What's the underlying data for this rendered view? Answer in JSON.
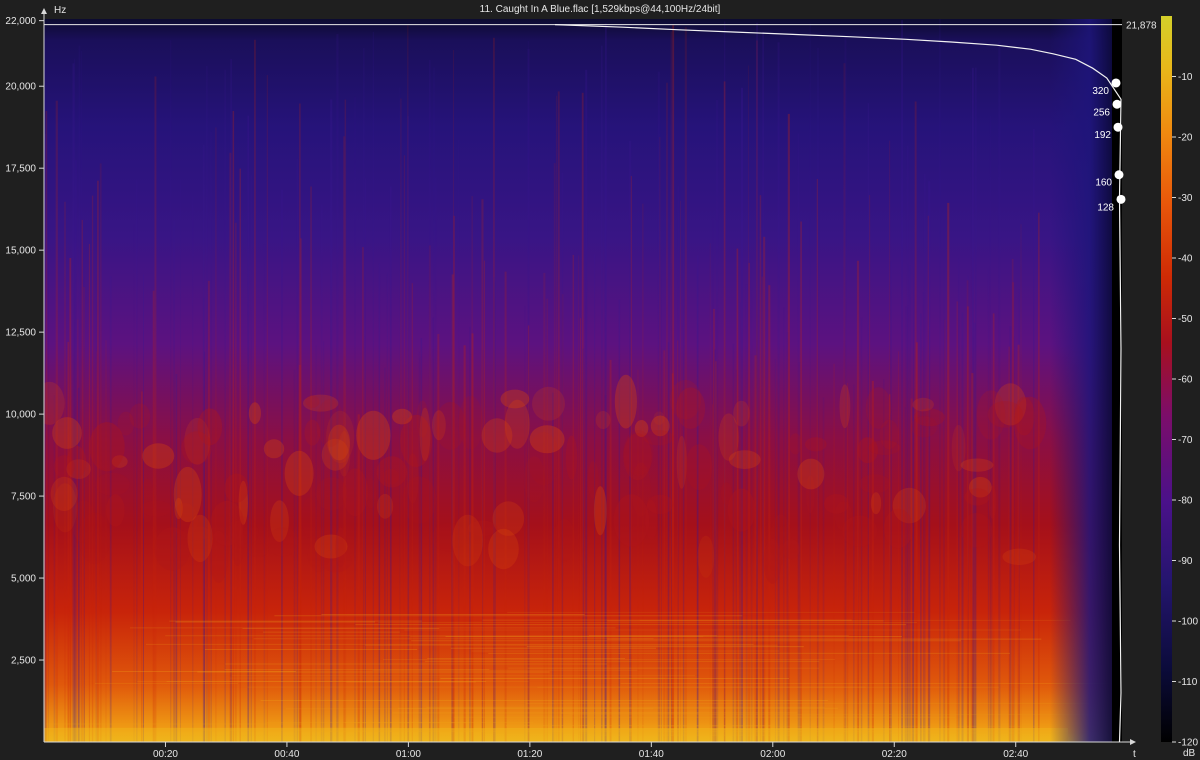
{
  "chart_data": {
    "type": "heatmap",
    "title": "11. Caught In A Blue.flac [1,529kbps@44,100Hz/24bit]",
    "ylabel": "Hz",
    "xlabel": "t",
    "colorbar_label": "dB",
    "y_ticks": [
      {
        "value": 22000,
        "label": "22,000"
      },
      {
        "value": 20000,
        "label": "20,000"
      },
      {
        "value": 17500,
        "label": "17,500"
      },
      {
        "value": 15000,
        "label": "15,000"
      },
      {
        "value": 12500,
        "label": "12,500"
      },
      {
        "value": 10000,
        "label": "10,000"
      },
      {
        "value": 7500,
        "label": "7,500"
      },
      {
        "value": 5000,
        "label": "5,000"
      },
      {
        "value": 2500,
        "label": "2,500"
      }
    ],
    "ylim": [
      0,
      22050
    ],
    "x_ticks": [
      {
        "value": 20,
        "label": "00:20"
      },
      {
        "value": 40,
        "label": "00:40"
      },
      {
        "value": 60,
        "label": "01:00"
      },
      {
        "value": 80,
        "label": "01:20"
      },
      {
        "value": 100,
        "label": "01:40"
      },
      {
        "value": 120,
        "label": "02:00"
      },
      {
        "value": 140,
        "label": "02:20"
      },
      {
        "value": 160,
        "label": "02:40"
      }
    ],
    "xlim": [
      0,
      177.5
    ],
    "colorbar_ticks": [
      {
        "value": -10,
        "label": "-10"
      },
      {
        "value": -20,
        "label": "-20"
      },
      {
        "value": -30,
        "label": "-30"
      },
      {
        "value": -40,
        "label": "-40"
      },
      {
        "value": -50,
        "label": "-50"
      },
      {
        "value": -60,
        "label": "-60"
      },
      {
        "value": -70,
        "label": "-70"
      },
      {
        "value": -80,
        "label": "-80"
      },
      {
        "value": -90,
        "label": "-90"
      },
      {
        "value": -100,
        "label": "-100"
      },
      {
        "value": -110,
        "label": "-110"
      },
      {
        "value": -120,
        "label": "-120"
      }
    ],
    "colorbar_range": [
      -120,
      0
    ],
    "colors": [
      "#000000",
      "#0b0b3a",
      "#24156e",
      "#4a118a",
      "#7c0d6a",
      "#a8101e",
      "#cf2a05",
      "#e8560a",
      "#f08a10",
      "#e8b81a",
      "#d4cf2a"
    ],
    "cutoff_label": "21,878",
    "cutoff_hz": 21878,
    "bitrate_markers": [
      {
        "label": "320",
        "hz": 20100
      },
      {
        "label": "256",
        "hz": 19450
      },
      {
        "label": "192",
        "hz": 18750
      },
      {
        "label": "160",
        "hz": 17300
      },
      {
        "label": "128",
        "hz": 16550
      }
    ],
    "profile": [
      [
        0.0,
        21880
      ],
      [
        0.12,
        21800
      ],
      [
        0.22,
        21720
      ],
      [
        0.32,
        21650
      ],
      [
        0.42,
        21580
      ],
      [
        0.52,
        21510
      ],
      [
        0.62,
        21430
      ],
      [
        0.7,
        21350
      ],
      [
        0.78,
        21250
      ],
      [
        0.84,
        21130
      ],
      [
        0.88,
        20990
      ],
      [
        0.92,
        20820
      ],
      [
        0.95,
        20550
      ],
      [
        0.975,
        20250
      ],
      [
        1.0,
        19600
      ],
      [
        1.0,
        16600
      ],
      [
        1.0,
        12000
      ],
      [
        1.0,
        6000
      ],
      [
        1.0,
        1500
      ],
      [
        1.0,
        0
      ]
    ]
  }
}
